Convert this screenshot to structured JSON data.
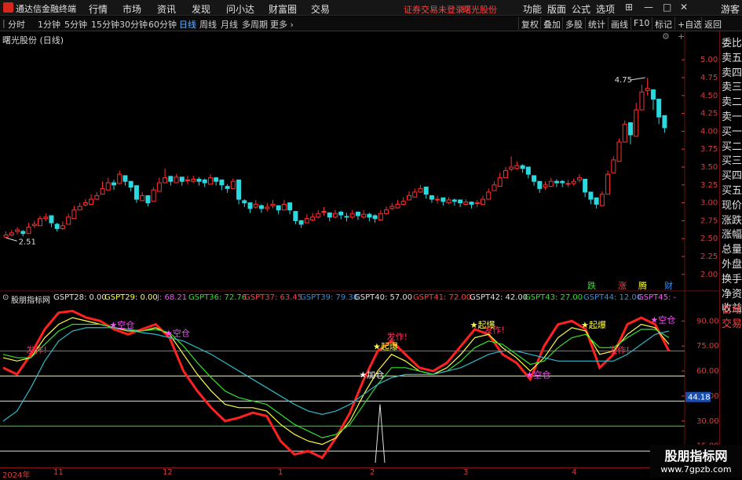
{
  "menubar": {
    "app_title": "通达信金融终端",
    "items": [
      "行情",
      "市场",
      "资讯",
      "发现",
      "问小达",
      "财富圈",
      "交易"
    ],
    "notice": "证券交易未登录",
    "stock_name": "曙光股份",
    "right_items": [
      "功能",
      "版面",
      "公式",
      "选项"
    ],
    "guest": "游客",
    "win_buttons": [
      "⊞",
      "—",
      "□",
      "✕"
    ]
  },
  "toolbar": {
    "periods": [
      "分时",
      "1分钟",
      "5分钟",
      "15分钟",
      "30分钟",
      "60分钟",
      "日线",
      "周线",
      "月线",
      "多周期",
      "更多 ›"
    ],
    "active_period": "日线",
    "buttons": [
      "复权",
      "叠加",
      "多股",
      "统计",
      "画线",
      "F10",
      "标记",
      "+自选",
      "返回"
    ]
  },
  "chart_header": {
    "title": "曙光股份 (日线)"
  },
  "right_panel": {
    "items": [
      "委比",
      "卖五",
      "卖四",
      "卖三",
      "卖二",
      "卖一",
      "买一",
      "买二",
      "买三",
      "买四",
      "买五",
      "现价",
      "涨跌",
      "涨幅",
      "总量",
      "外盘",
      "换手",
      "净资",
      "收益",
      "自动",
      "交易"
    ]
  },
  "colors": {
    "up": "#ff3030",
    "down": "#2ad8e0",
    "grid": "#6a1010",
    "axis_text": "#d04040"
  },
  "chart_data": [
    {
      "type": "candlestick",
      "y_ticks": [
        "5.00",
        "4.75",
        "4.50",
        "4.25",
        "4.00",
        "3.75",
        "3.50",
        "3.25",
        "3.00",
        "2.75",
        "2.50",
        "2.25",
        "2.00"
      ],
      "ylim": [
        1.8,
        5.2
      ],
      "annotations": {
        "high": "4.75",
        "low": "2.51"
      },
      "bottom_labels": [
        "跌",
        "涨",
        "腾",
        "财"
      ],
      "closes": [
        2.55,
        2.58,
        2.62,
        2.57,
        2.66,
        2.7,
        2.78,
        2.8,
        2.72,
        2.64,
        2.68,
        2.8,
        2.9,
        2.95,
        3.0,
        3.05,
        3.1,
        3.2,
        3.28,
        3.25,
        3.4,
        3.3,
        3.22,
        3.05,
        3.1,
        3.0,
        3.18,
        3.28,
        3.35,
        3.3,
        3.36,
        3.3,
        3.32,
        3.33,
        3.3,
        3.28,
        3.35,
        3.3,
        3.25,
        3.2,
        3.3,
        3.05,
        3.0,
        2.92,
        2.98,
        2.92,
        2.94,
        2.98,
        2.9,
        2.98,
        2.9,
        2.75,
        2.7,
        2.78,
        2.8,
        2.85,
        2.88,
        2.8,
        2.85,
        2.83,
        2.8,
        2.85,
        2.82,
        2.84,
        2.8,
        2.78,
        2.85,
        2.9,
        2.95,
        2.98,
        3.02,
        3.1,
        3.15,
        3.2,
        3.12,
        3.05,
        3.05,
        3.02,
        3.04,
        3.02,
        3.0,
        3.01,
        2.98,
        3.0,
        3.05,
        3.15,
        3.25,
        3.35,
        3.45,
        3.5,
        3.52,
        3.48,
        3.4,
        3.3,
        3.2,
        3.25,
        3.3,
        3.28,
        3.28,
        3.27,
        3.3,
        3.35,
        3.15,
        3.05,
        2.98,
        3.12,
        3.4,
        3.6,
        3.85,
        4.1,
        3.95,
        4.3,
        4.55,
        4.6,
        4.45,
        4.2,
        4.05
      ],
      "highs": [
        2.6,
        2.62,
        2.66,
        2.62,
        2.72,
        2.75,
        2.82,
        2.85,
        2.78,
        2.72,
        2.74,
        2.85,
        2.96,
        3.0,
        3.05,
        3.12,
        3.15,
        3.3,
        3.35,
        3.32,
        3.45,
        3.38,
        3.3,
        3.12,
        3.15,
        3.08,
        3.22,
        3.35,
        3.48,
        3.36,
        3.4,
        3.36,
        3.38,
        3.38,
        3.36,
        3.34,
        3.4,
        3.36,
        3.3,
        3.26,
        3.34,
        3.12,
        3.05,
        2.98,
        3.04,
        2.98,
        3.0,
        3.04,
        2.96,
        3.04,
        2.96,
        2.82,
        2.76,
        2.84,
        2.86,
        2.9,
        2.94,
        2.86,
        2.9,
        2.89,
        2.86,
        2.9,
        2.88,
        2.9,
        2.86,
        2.84,
        2.9,
        2.95,
        3.0,
        3.04,
        3.08,
        3.16,
        3.2,
        3.25,
        3.18,
        3.1,
        3.1,
        3.06,
        3.08,
        3.06,
        3.04,
        3.05,
        3.02,
        3.04,
        3.1,
        3.2,
        3.3,
        3.42,
        3.5,
        3.65,
        3.58,
        3.54,
        3.46,
        3.36,
        3.26,
        3.3,
        3.35,
        3.33,
        3.32,
        3.32,
        3.34,
        3.4,
        3.2,
        3.1,
        3.02,
        3.16,
        3.45,
        3.65,
        3.9,
        4.15,
        4.05,
        4.4,
        4.65,
        4.75,
        4.52,
        4.28,
        4.12
      ],
      "lows": [
        2.51,
        2.53,
        2.56,
        2.53,
        2.6,
        2.65,
        2.72,
        2.74,
        2.66,
        2.6,
        2.62,
        2.74,
        2.84,
        2.9,
        2.95,
        3.0,
        3.04,
        3.14,
        3.22,
        3.18,
        3.32,
        3.24,
        3.16,
        3.0,
        3.04,
        2.95,
        3.1,
        3.22,
        3.28,
        3.24,
        3.3,
        3.24,
        3.26,
        3.28,
        3.24,
        3.22,
        3.28,
        3.24,
        3.18,
        3.14,
        3.22,
        2.98,
        2.94,
        2.86,
        2.92,
        2.86,
        2.88,
        2.92,
        2.84,
        2.92,
        2.84,
        2.7,
        2.65,
        2.72,
        2.74,
        2.78,
        2.82,
        2.74,
        2.78,
        2.77,
        2.74,
        2.78,
        2.76,
        2.78,
        2.74,
        2.72,
        2.78,
        2.84,
        2.9,
        2.92,
        2.96,
        3.04,
        3.1,
        3.14,
        3.06,
        3.0,
        2.99,
        2.96,
        2.98,
        2.96,
        2.94,
        2.96,
        2.92,
        2.94,
        2.98,
        3.08,
        3.18,
        3.28,
        3.38,
        3.44,
        3.46,
        3.42,
        3.34,
        3.24,
        3.14,
        3.18,
        3.22,
        3.22,
        3.22,
        3.22,
        3.24,
        3.28,
        3.08,
        2.98,
        2.92,
        3.04,
        3.3,
        3.52,
        3.76,
        3.96,
        3.82,
        4.18,
        4.4,
        4.5,
        4.3,
        4.1,
        3.98
      ]
    },
    {
      "type": "line",
      "title": "股朋指标网",
      "legend": [
        {
          "text": "GSPT28: 0.00",
          "color": "#e0e0e0"
        },
        {
          "text": "GSPT29: 0.00",
          "color": "#ffff40"
        },
        {
          "text": "J: 68.21",
          "color": "#ff50ff"
        },
        {
          "text": "GSPT36: 72.76",
          "color": "#30e030"
        },
        {
          "text": "GSPT37: 63.45",
          "color": "#ff4040"
        },
        {
          "text": "GSPT39: 79.38",
          "color": "#3090e0"
        },
        {
          "text": "GSPT40: 57.00",
          "color": "#e0e0e0"
        },
        {
          "text": "GSPT41: 72.00",
          "color": "#ff4040"
        },
        {
          "text": "GSPT42: 42.00",
          "color": "#e0e0e0"
        },
        {
          "text": "GSPT43: 27.00",
          "color": "#30e030"
        },
        {
          "text": "GSPT44: 12.00",
          "color": "#3090e0"
        },
        {
          "text": "GSPT45: -",
          "color": "#ff50ff"
        }
      ],
      "y_ticks": [
        "90.00",
        "75.00",
        "60.00",
        "45.00",
        "30.00",
        "15.00"
      ],
      "ylim": [
        5,
        100
      ],
      "current_value": "44.18",
      "levels": [
        {
          "value": 72,
          "color": "#ff3a6a"
        },
        {
          "value": 57,
          "color": "#ffff40"
        },
        {
          "value": 42,
          "color": "#e0e0e0"
        },
        {
          "value": 27,
          "color": "#30e030"
        },
        {
          "value": 12,
          "color": "#e0e0e0"
        }
      ],
      "series": [
        {
          "color": "#ff2020",
          "values": [
            62,
            58,
            70,
            85,
            95,
            96,
            92,
            90,
            85,
            82,
            85,
            88,
            80,
            60,
            48,
            38,
            30,
            32,
            35,
            33,
            18,
            10,
            12,
            8,
            20,
            35,
            55,
            72,
            78,
            70,
            62,
            60,
            65,
            75,
            85,
            82,
            70,
            65,
            55,
            75,
            88,
            90,
            85,
            62,
            70,
            88,
            92,
            88,
            72
          ]
        },
        {
          "color": "#ffff40",
          "values": [
            68,
            66,
            68,
            80,
            88,
            92,
            90,
            88,
            86,
            84,
            84,
            86,
            82,
            70,
            58,
            48,
            40,
            38,
            38,
            36,
            28,
            22,
            18,
            16,
            20,
            30,
            46,
            60,
            70,
            66,
            60,
            58,
            62,
            70,
            80,
            82,
            74,
            68,
            60,
            68,
            80,
            86,
            84,
            70,
            72,
            82,
            88,
            86,
            76
          ]
        },
        {
          "color": "#30e030",
          "values": [
            70,
            68,
            68,
            76,
            84,
            88,
            88,
            88,
            86,
            85,
            84,
            85,
            83,
            75,
            65,
            56,
            48,
            44,
            42,
            40,
            34,
            28,
            24,
            20,
            22,
            28,
            40,
            52,
            62,
            62,
            60,
            58,
            60,
            66,
            74,
            78,
            76,
            70,
            64,
            66,
            74,
            80,
            82,
            74,
            74,
            80,
            85,
            85,
            80
          ]
        },
        {
          "color": "#30b8c8",
          "values": [
            30,
            36,
            50,
            66,
            78,
            84,
            86,
            86,
            86,
            85,
            83,
            82,
            80,
            78,
            74,
            70,
            65,
            60,
            55,
            50,
            45,
            40,
            36,
            34,
            36,
            40,
            46,
            52,
            56,
            58,
            58,
            58,
            60,
            62,
            66,
            70,
            72,
            72,
            70,
            68,
            66,
            66,
            66,
            66,
            66,
            70,
            76,
            82,
            84
          ]
        }
      ],
      "signals": [
        {
          "text": "发作!",
          "color": "#ff3060",
          "i": 2
        },
        {
          "text": "★空仓",
          "color": "#ff50ff",
          "i": 8
        },
        {
          "text": "★空仓",
          "color": "#ff50ff",
          "i": 12
        },
        {
          "text": "★加仓",
          "color": "#ffffff",
          "i": 26
        },
        {
          "text": "★起爆",
          "color": "#ffff40",
          "i": 27
        },
        {
          "text": "发作!",
          "color": "#ff3060",
          "i": 28
        },
        {
          "text": "★起爆",
          "color": "#ffff40",
          "i": 34
        },
        {
          "text": "发作!",
          "color": "#ff3060",
          "i": 35
        },
        {
          "text": "★空仓",
          "color": "#ff50ff",
          "i": 38
        },
        {
          "text": "★起爆",
          "color": "#ffff40",
          "i": 42
        },
        {
          "text": "发作!",
          "color": "#ff3060",
          "i": 44
        },
        {
          "text": "★空仓",
          "color": "#ff50ff",
          "i": 47
        }
      ]
    }
  ],
  "date_axis": {
    "labels": [
      "2024年",
      "11",
      "12",
      "1",
      "2",
      "3",
      "4"
    ]
  },
  "watermark": {
    "line1": "股朋指标网",
    "line2": "www.7gpzb.com"
  }
}
